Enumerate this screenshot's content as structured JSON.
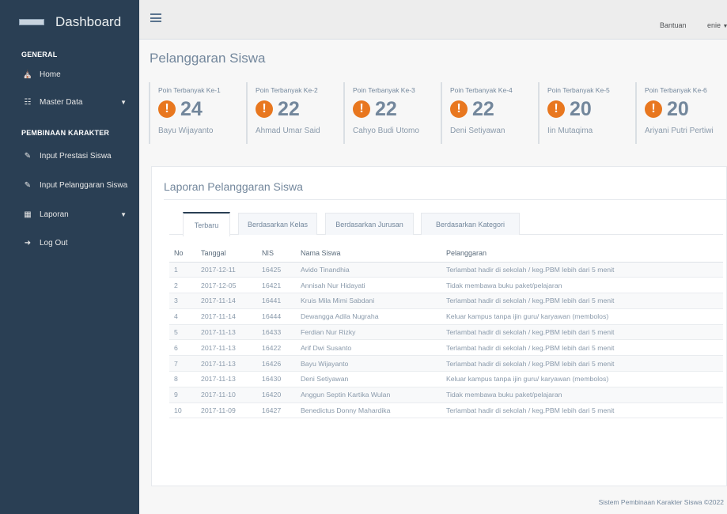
{
  "sidebar": {
    "brand_title": "Dashboard",
    "section_general": "GENERAL",
    "section_pembinaan": "PEMBINAAN KARAKTER",
    "items": [
      {
        "label": "Home",
        "icon": "home-icon"
      },
      {
        "label": "Master Data",
        "icon": "sitemap-icon"
      },
      {
        "label": "Input Prestasi Siswa",
        "icon": "edit-icon"
      },
      {
        "label": "Input Pelanggaran Siswa",
        "icon": "edit-icon"
      },
      {
        "label": "Laporan",
        "icon": "table-icon"
      },
      {
        "label": "Log Out",
        "icon": "sign-out-icon"
      }
    ]
  },
  "topbar": {
    "help_label": "Bantuan",
    "user_label": "enie"
  },
  "page": {
    "title": "Pelanggaran Siswa"
  },
  "stats": [
    {
      "label": "Poin Terbanyak Ke-1",
      "value": "24",
      "name": "Bayu Wijayanto"
    },
    {
      "label": "Poin Terbanyak Ke-2",
      "value": "22",
      "name": "Ahmad Umar Said"
    },
    {
      "label": "Poin Terbanyak Ke-3",
      "value": "22",
      "name": "Cahyo Budi Utomo"
    },
    {
      "label": "Poin Terbanyak Ke-4",
      "value": "22",
      "name": "Deni Setiyawan"
    },
    {
      "label": "Poin Terbanyak Ke-5",
      "value": "20",
      "name": "Iin Mutaqima"
    },
    {
      "label": "Poin Terbanyak Ke-6",
      "value": "20",
      "name": "Ariyani Putri Pertiwi"
    }
  ],
  "report": {
    "title": "Laporan Pelanggaran Siswa",
    "tabs": [
      "Terbaru",
      "Berdasarkan Kelas",
      "Berdasarkan Jurusan",
      "Berdasarkan Kategori"
    ],
    "columns": [
      "No",
      "Tanggal",
      "NIS",
      "Nama Siswa",
      "Pelanggaran"
    ],
    "rows": [
      [
        "1",
        "2017-12-11",
        "16425",
        "Avido Tinandhia",
        "Terlambat hadir di sekolah / keg.PBM lebih dari 5 menit"
      ],
      [
        "2",
        "2017-12-05",
        "16421",
        "Annisah Nur Hidayati",
        "Tidak membawa buku paket/pelajaran"
      ],
      [
        "3",
        "2017-11-14",
        "16441",
        "Kruis Mila Mimi Sabdani",
        "Terlambat hadir di sekolah / keg.PBM lebih dari 5 menit"
      ],
      [
        "4",
        "2017-11-14",
        "16444",
        "Dewangga Adila Nugraha",
        "Keluar kampus tanpa ijin guru/ karyawan (membolos)"
      ],
      [
        "5",
        "2017-11-13",
        "16433",
        "Ferdian Nur Rizky",
        "Terlambat hadir di sekolah / keg.PBM lebih dari 5 menit"
      ],
      [
        "6",
        "2017-11-13",
        "16422",
        "Arif Dwi Susanto",
        "Terlambat hadir di sekolah / keg.PBM lebih dari 5 menit"
      ],
      [
        "7",
        "2017-11-13",
        "16426",
        "Bayu Wijayanto",
        "Terlambat hadir di sekolah / keg.PBM lebih dari 5 menit"
      ],
      [
        "8",
        "2017-11-13",
        "16430",
        "Deni Setiyawan",
        "Keluar kampus tanpa ijin guru/ karyawan (membolos)"
      ],
      [
        "9",
        "2017-11-10",
        "16420",
        "Anggun Septin Kartika Wulan",
        "Tidak membawa buku paket/pelajaran"
      ],
      [
        "10",
        "2017-11-09",
        "16427",
        "Benedictus Donny Mahardika",
        "Terlambat hadir di sekolah / keg.PBM lebih dari 5 menit"
      ]
    ]
  },
  "footer": {
    "text": "Sistem Pembinaan Karakter Siswa ©2022"
  }
}
